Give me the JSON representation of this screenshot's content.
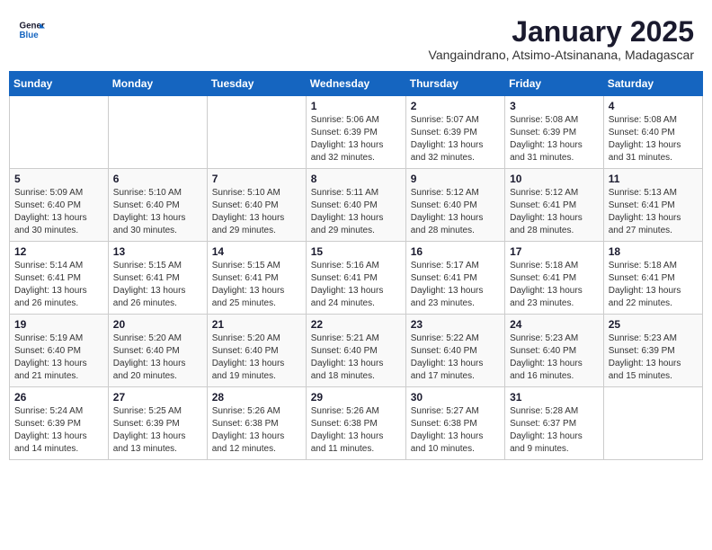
{
  "header": {
    "logo_line1": "General",
    "logo_line2": "Blue",
    "title": "January 2025",
    "subtitle": "Vangaindrano, Atsimo-Atsinanana, Madagascar"
  },
  "weekdays": [
    "Sunday",
    "Monday",
    "Tuesday",
    "Wednesday",
    "Thursday",
    "Friday",
    "Saturday"
  ],
  "weeks": [
    [
      {
        "day": "",
        "info": ""
      },
      {
        "day": "",
        "info": ""
      },
      {
        "day": "",
        "info": ""
      },
      {
        "day": "1",
        "info": "Sunrise: 5:06 AM\nSunset: 6:39 PM\nDaylight: 13 hours\nand 32 minutes."
      },
      {
        "day": "2",
        "info": "Sunrise: 5:07 AM\nSunset: 6:39 PM\nDaylight: 13 hours\nand 32 minutes."
      },
      {
        "day": "3",
        "info": "Sunrise: 5:08 AM\nSunset: 6:39 PM\nDaylight: 13 hours\nand 31 minutes."
      },
      {
        "day": "4",
        "info": "Sunrise: 5:08 AM\nSunset: 6:40 PM\nDaylight: 13 hours\nand 31 minutes."
      }
    ],
    [
      {
        "day": "5",
        "info": "Sunrise: 5:09 AM\nSunset: 6:40 PM\nDaylight: 13 hours\nand 30 minutes."
      },
      {
        "day": "6",
        "info": "Sunrise: 5:10 AM\nSunset: 6:40 PM\nDaylight: 13 hours\nand 30 minutes."
      },
      {
        "day": "7",
        "info": "Sunrise: 5:10 AM\nSunset: 6:40 PM\nDaylight: 13 hours\nand 29 minutes."
      },
      {
        "day": "8",
        "info": "Sunrise: 5:11 AM\nSunset: 6:40 PM\nDaylight: 13 hours\nand 29 minutes."
      },
      {
        "day": "9",
        "info": "Sunrise: 5:12 AM\nSunset: 6:40 PM\nDaylight: 13 hours\nand 28 minutes."
      },
      {
        "day": "10",
        "info": "Sunrise: 5:12 AM\nSunset: 6:41 PM\nDaylight: 13 hours\nand 28 minutes."
      },
      {
        "day": "11",
        "info": "Sunrise: 5:13 AM\nSunset: 6:41 PM\nDaylight: 13 hours\nand 27 minutes."
      }
    ],
    [
      {
        "day": "12",
        "info": "Sunrise: 5:14 AM\nSunset: 6:41 PM\nDaylight: 13 hours\nand 26 minutes."
      },
      {
        "day": "13",
        "info": "Sunrise: 5:15 AM\nSunset: 6:41 PM\nDaylight: 13 hours\nand 26 minutes."
      },
      {
        "day": "14",
        "info": "Sunrise: 5:15 AM\nSunset: 6:41 PM\nDaylight: 13 hours\nand 25 minutes."
      },
      {
        "day": "15",
        "info": "Sunrise: 5:16 AM\nSunset: 6:41 PM\nDaylight: 13 hours\nand 24 minutes."
      },
      {
        "day": "16",
        "info": "Sunrise: 5:17 AM\nSunset: 6:41 PM\nDaylight: 13 hours\nand 23 minutes."
      },
      {
        "day": "17",
        "info": "Sunrise: 5:18 AM\nSunset: 6:41 PM\nDaylight: 13 hours\nand 23 minutes."
      },
      {
        "day": "18",
        "info": "Sunrise: 5:18 AM\nSunset: 6:41 PM\nDaylight: 13 hours\nand 22 minutes."
      }
    ],
    [
      {
        "day": "19",
        "info": "Sunrise: 5:19 AM\nSunset: 6:40 PM\nDaylight: 13 hours\nand 21 minutes."
      },
      {
        "day": "20",
        "info": "Sunrise: 5:20 AM\nSunset: 6:40 PM\nDaylight: 13 hours\nand 20 minutes."
      },
      {
        "day": "21",
        "info": "Sunrise: 5:20 AM\nSunset: 6:40 PM\nDaylight: 13 hours\nand 19 minutes."
      },
      {
        "day": "22",
        "info": "Sunrise: 5:21 AM\nSunset: 6:40 PM\nDaylight: 13 hours\nand 18 minutes."
      },
      {
        "day": "23",
        "info": "Sunrise: 5:22 AM\nSunset: 6:40 PM\nDaylight: 13 hours\nand 17 minutes."
      },
      {
        "day": "24",
        "info": "Sunrise: 5:23 AM\nSunset: 6:40 PM\nDaylight: 13 hours\nand 16 minutes."
      },
      {
        "day": "25",
        "info": "Sunrise: 5:23 AM\nSunset: 6:39 PM\nDaylight: 13 hours\nand 15 minutes."
      }
    ],
    [
      {
        "day": "26",
        "info": "Sunrise: 5:24 AM\nSunset: 6:39 PM\nDaylight: 13 hours\nand 14 minutes."
      },
      {
        "day": "27",
        "info": "Sunrise: 5:25 AM\nSunset: 6:39 PM\nDaylight: 13 hours\nand 13 minutes."
      },
      {
        "day": "28",
        "info": "Sunrise: 5:26 AM\nSunset: 6:38 PM\nDaylight: 13 hours\nand 12 minutes."
      },
      {
        "day": "29",
        "info": "Sunrise: 5:26 AM\nSunset: 6:38 PM\nDaylight: 13 hours\nand 11 minutes."
      },
      {
        "day": "30",
        "info": "Sunrise: 5:27 AM\nSunset: 6:38 PM\nDaylight: 13 hours\nand 10 minutes."
      },
      {
        "day": "31",
        "info": "Sunrise: 5:28 AM\nSunset: 6:37 PM\nDaylight: 13 hours\nand 9 minutes."
      },
      {
        "day": "",
        "info": ""
      }
    ]
  ]
}
